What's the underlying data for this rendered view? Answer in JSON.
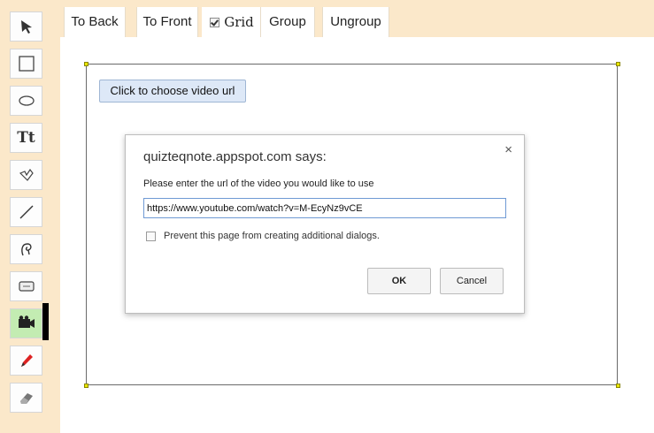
{
  "toolbar": {
    "to_back_label": "To Back",
    "to_front_label": "To Front",
    "grid_label": "Grid",
    "grid_checked": true,
    "group_label": "Group",
    "ungroup_label": "Ungroup"
  },
  "tools": [
    {
      "name": "select",
      "icon": "arrow-pointer-icon"
    },
    {
      "name": "rectangle",
      "icon": "rectangle-icon"
    },
    {
      "name": "ellipse",
      "icon": "ellipse-icon"
    },
    {
      "name": "text",
      "icon": "text-icon",
      "glyph": "Tt"
    },
    {
      "name": "shape",
      "icon": "polygon-icon"
    },
    {
      "name": "line",
      "icon": "line-icon"
    },
    {
      "name": "freehand",
      "icon": "freehand-icon"
    },
    {
      "name": "button",
      "icon": "button-widget-icon"
    },
    {
      "name": "video",
      "icon": "video-icon",
      "active": true
    },
    {
      "name": "pen",
      "icon": "pen-icon"
    },
    {
      "name": "eraser",
      "icon": "eraser-icon"
    }
  ],
  "canvas": {
    "video_button_label": "Click to choose video url"
  },
  "dialog": {
    "title": "quizteqnote.appspot.com says:",
    "message": "Please enter the url of the video you would like to use",
    "input_value": "https://www.youtube.com/watch?v=M-EcyNz9vCE",
    "prevent_label": "Prevent this page from creating additional dialogs.",
    "prevent_checked": false,
    "ok_label": "OK",
    "cancel_label": "Cancel",
    "close_glyph": "×"
  },
  "colors": {
    "panel_bg": "#fbe8ca",
    "active_tool_bg": "#c3ecb2",
    "video_button_bg": "#dde8f7",
    "input_border": "#6f9ad4"
  }
}
